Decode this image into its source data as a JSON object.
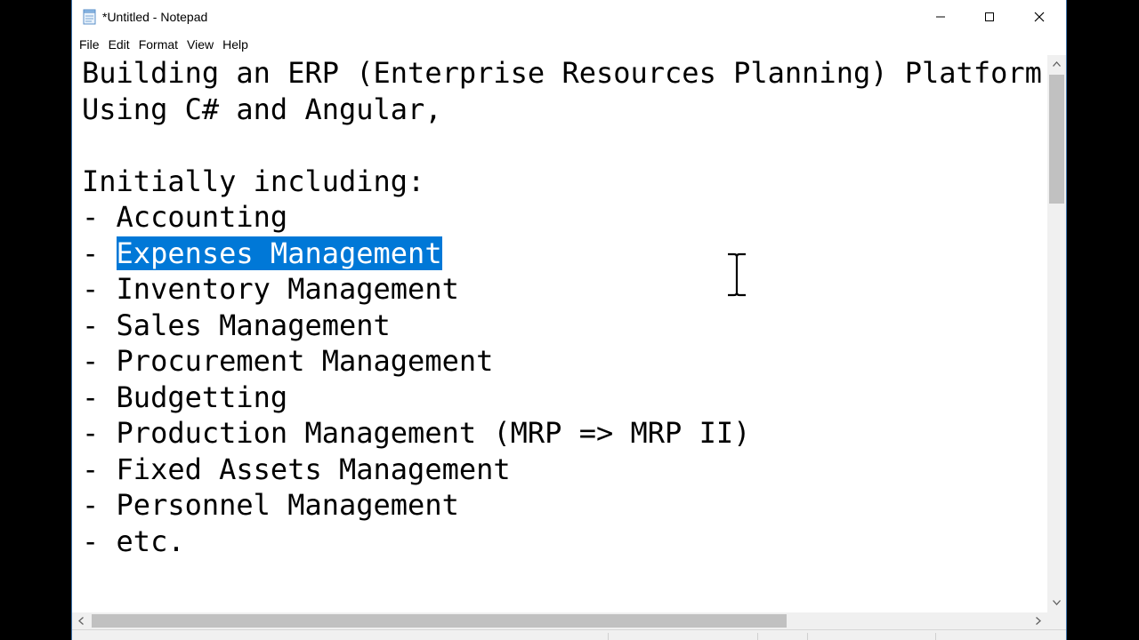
{
  "window": {
    "title": "*Untitled - Notepad",
    "minimize_icon": "minimize-icon",
    "maximize_icon": "maximize-icon",
    "close_icon": "close-icon"
  },
  "menu": {
    "items": [
      "File",
      "Edit",
      "Format",
      "View",
      "Help"
    ]
  },
  "document": {
    "lines": [
      "Building an ERP (Enterprise Resources Planning) Platform",
      "Using C# and Angular,",
      "",
      "Initially including:",
      "- Accounting",
      "- ",
      "- Inventory Management",
      "- Sales Management",
      "- Procurement Management",
      "- Budgetting",
      "- Production Management (MRP => MRP II)",
      "- Fixed Assets Management",
      "- Personnel Management",
      "- etc."
    ],
    "selected_text": "Expenses Management"
  },
  "colors": {
    "selection": "#0078d7",
    "background": "#ffffff",
    "outer_background": "#000000"
  }
}
